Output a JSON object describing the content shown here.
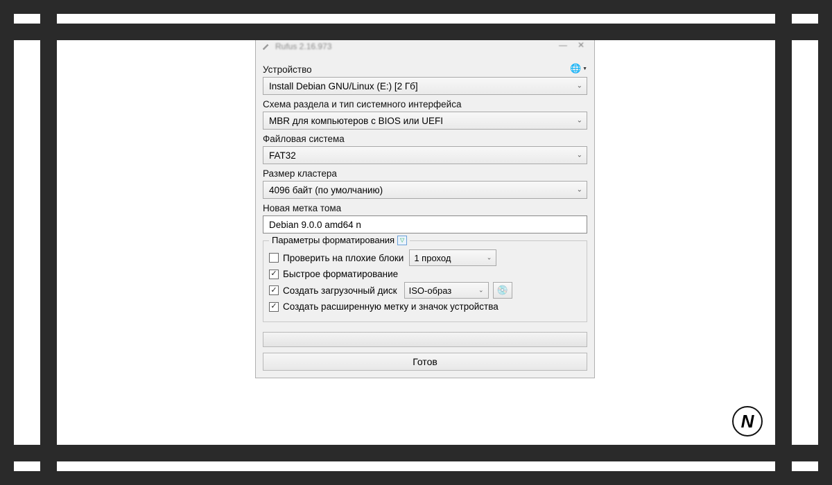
{
  "title": "Rufus 2.16.973",
  "device": {
    "label": "Устройство",
    "value": "Install Debian GNU/Linux (E:) [2 Гб]"
  },
  "partition": {
    "label": "Схема раздела и тип системного интерфейса",
    "value": "MBR для компьютеров с BIOS или UEFI"
  },
  "filesystem": {
    "label": "Файловая система",
    "value": "FAT32"
  },
  "cluster": {
    "label": "Размер кластера",
    "value": "4096 байт (по умолчанию)"
  },
  "volume": {
    "label": "Новая метка тома",
    "value": "Debian 9.0.0 amd64 n"
  },
  "format": {
    "legend": "Параметры форматирования",
    "badblocks": {
      "checked": false,
      "label": "Проверить на плохие блоки",
      "passes": "1 проход"
    },
    "quick": {
      "checked": true,
      "label": "Быстрое форматирование"
    },
    "bootable": {
      "checked": true,
      "label": "Создать загрузочный диск",
      "type": "ISO-образ"
    },
    "extended": {
      "checked": true,
      "label": "Создать расширенную метку и значок устройства"
    }
  },
  "status": "Готов",
  "watermark": "N"
}
